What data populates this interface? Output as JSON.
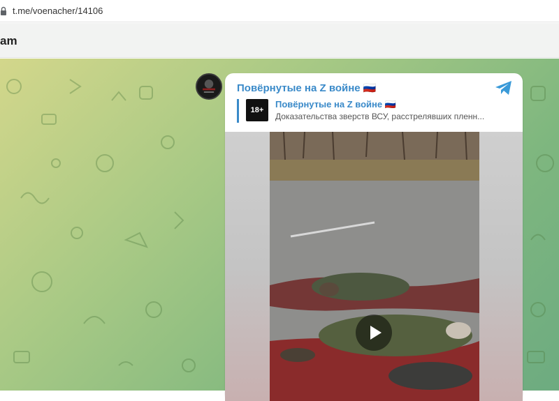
{
  "browser": {
    "url": "t.me/voenacher/14106",
    "lock_icon": "lock-icon"
  },
  "header": {
    "title": "am"
  },
  "message": {
    "channel_name": "Повёрнутые на Z войне 🇷🇺",
    "reply": {
      "thumb_label": "18+",
      "title": "Повёрнутые на Z войне 🇷🇺",
      "text": "Доказательства зверств ВСУ, расстрелявших пленн..."
    },
    "icons": {
      "telegram": "telegram-icon",
      "play": "play-icon"
    }
  },
  "colors": {
    "accent": "#3a8ac9",
    "header_bg": "#f2f3f2"
  }
}
